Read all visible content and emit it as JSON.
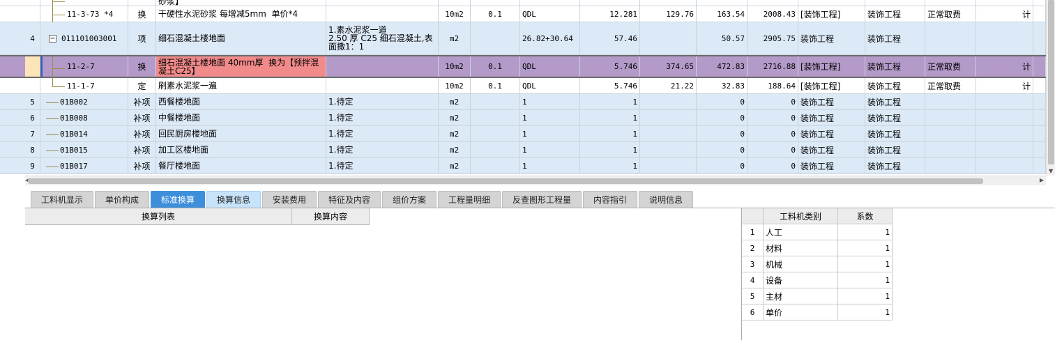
{
  "grid": {
    "rows": [
      {
        "kind": "partial-top",
        "rownum": "",
        "code": "",
        "type": "",
        "name": "砂浆】",
        "feature": "",
        "unit": "",
        "factor": "",
        "expr": "",
        "qty": "",
        "price": "",
        "unit_total": "",
        "total": "",
        "prof1": "",
        "prof2": "",
        "fee": "",
        "extra": ""
      },
      {
        "kind": "sub",
        "rownum": "",
        "code": "11-3-73 *4",
        "type": "换",
        "name": "干硬性水泥砂浆 每增减5mm  单价*4",
        "feature": "",
        "unit": "10m2",
        "factor": "0.1",
        "expr": "QDL",
        "qty": "12.281",
        "price": "129.76",
        "unit_total": "163.54",
        "total": "2008.43",
        "prof1": "[装饰工程]",
        "prof2": "装饰工程",
        "fee": "正常取费",
        "extra": "计"
      },
      {
        "kind": "item",
        "rownum": "4",
        "code": "011101003001",
        "type": "项",
        "name": "细石混凝土楼地面",
        "feature": "1.素水泥浆一道\n2.50 厚 C25 细石混凝土,表面撒1：1",
        "unit": "m2",
        "factor": "",
        "expr": "26.82+30.64",
        "qty": "57.46",
        "price": "",
        "unit_total": "50.57",
        "total": "2905.75",
        "prof1": "装饰工程",
        "prof2": "装饰工程",
        "fee": "",
        "extra": ""
      },
      {
        "kind": "selected",
        "rownum": "",
        "code": "11-2-7",
        "type": "换",
        "name": "细石混凝土楼地面 40mm厚  换为【预拌混凝土C25】",
        "feature": "",
        "unit": "10m2",
        "factor": "0.1",
        "expr": "QDL",
        "qty": "5.746",
        "price": "374.65",
        "unit_total": "472.83",
        "total": "2716.88",
        "prof1": "[装饰工程]",
        "prof2": "装饰工程",
        "fee": "正常取费",
        "extra": "计"
      },
      {
        "kind": "sub",
        "rownum": "",
        "code": "11-1-7",
        "type": "定",
        "name": "刷素水泥浆一遍",
        "feature": "",
        "unit": "10m2",
        "factor": "0.1",
        "expr": "QDL",
        "qty": "5.746",
        "price": "21.22",
        "unit_total": "32.83",
        "total": "188.64",
        "prof1": "[装饰工程]",
        "prof2": "装饰工程",
        "fee": "正常取费",
        "extra": "计"
      },
      {
        "kind": "supp",
        "rownum": "5",
        "code": "01B002",
        "type": "补项",
        "name": "西餐楼地面",
        "feature": "1.待定",
        "unit": "m2",
        "factor": "",
        "expr": "1",
        "qty": "1",
        "price": "",
        "unit_total": "0",
        "total": "0",
        "prof1": "装饰工程",
        "prof2": "装饰工程",
        "fee": "",
        "extra": ""
      },
      {
        "kind": "supp",
        "rownum": "6",
        "code": "01B008",
        "type": "补项",
        "name": "中餐楼地面",
        "feature": "1.待定",
        "unit": "m2",
        "factor": "",
        "expr": "1",
        "qty": "1",
        "price": "",
        "unit_total": "0",
        "total": "0",
        "prof1": "装饰工程",
        "prof2": "装饰工程",
        "fee": "",
        "extra": ""
      },
      {
        "kind": "supp",
        "rownum": "7",
        "code": "01B014",
        "type": "补项",
        "name": "回民厨房楼地面",
        "feature": "1.待定",
        "unit": "m2",
        "factor": "",
        "expr": "1",
        "qty": "1",
        "price": "",
        "unit_total": "0",
        "total": "0",
        "prof1": "装饰工程",
        "prof2": "装饰工程",
        "fee": "",
        "extra": ""
      },
      {
        "kind": "supp",
        "rownum": "8",
        "code": "01B015",
        "type": "补项",
        "name": "加工区楼地面",
        "feature": "1.待定",
        "unit": "m2",
        "factor": "",
        "expr": "1",
        "qty": "1",
        "price": "",
        "unit_total": "0",
        "total": "0",
        "prof1": "装饰工程",
        "prof2": "装饰工程",
        "fee": "",
        "extra": ""
      },
      {
        "kind": "supp",
        "rownum": "9",
        "code": "01B017",
        "type": "补项",
        "name": "餐厅楼地面",
        "feature": "1.待定",
        "unit": "m2",
        "factor": "",
        "expr": "1",
        "qty": "1",
        "price": "",
        "unit_total": "0",
        "total": "0",
        "prof1": "装饰工程",
        "prof2": "装饰工程",
        "fee": "",
        "extra": ""
      }
    ],
    "collapse_symbol": "−"
  },
  "tabs": [
    {
      "label": "工料机显示"
    },
    {
      "label": "单价构成"
    },
    {
      "label": "标准换算"
    },
    {
      "label": "换算信息"
    },
    {
      "label": "安装费用"
    },
    {
      "label": "特征及内容"
    },
    {
      "label": "组价方案"
    },
    {
      "label": "工程量明细"
    },
    {
      "label": "反查图形工程量"
    },
    {
      "label": "内容指引"
    },
    {
      "label": "说明信息"
    }
  ],
  "conversion": {
    "col_list": "换算列表",
    "col_content": "换算内容"
  },
  "coefficients": {
    "col_type": "工料机类别",
    "col_factor": "系数",
    "rows": [
      {
        "n": "1",
        "type": "人工",
        "factor": "1"
      },
      {
        "n": "2",
        "type": "材料",
        "factor": "1"
      },
      {
        "n": "3",
        "type": "机械",
        "factor": "1"
      },
      {
        "n": "4",
        "type": "设备",
        "factor": "1"
      },
      {
        "n": "5",
        "type": "主材",
        "factor": "1"
      },
      {
        "n": "6",
        "type": "单价",
        "factor": "1"
      }
    ]
  },
  "colors": {
    "row_blue": "#dce9f7",
    "row_selected": "#b39ac8",
    "cell_highlight": "#f18a8a",
    "tab_active": "#3d8fdc",
    "tab_hover": "#c7e3fa"
  }
}
